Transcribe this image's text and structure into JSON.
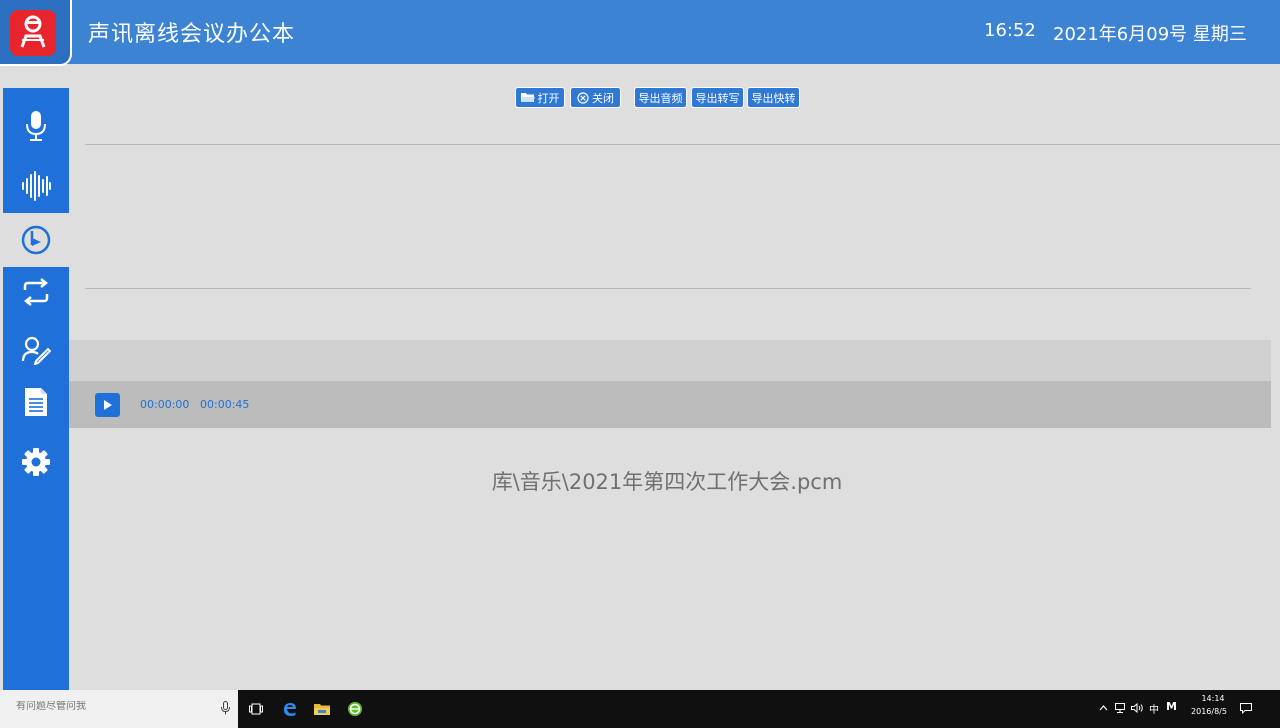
{
  "header": {
    "title": "声讯离线会议办公本",
    "time": "16:52",
    "date": "2021年6月09号  星期三"
  },
  "sidebar": {
    "items": [
      {
        "icon": "microphone-icon"
      },
      {
        "icon": "waveform-icon"
      },
      {
        "icon": "playback-icon"
      },
      {
        "icon": "convert-icon"
      },
      {
        "icon": "sign-icon"
      },
      {
        "icon": "document-icon"
      },
      {
        "icon": "gear-icon"
      }
    ]
  },
  "toolbar": {
    "open_label": "打开",
    "close_label": "关闭",
    "export_audio_label": "导出音频",
    "export_transcript_label": "导出转写",
    "export_quick_label": "导出快转"
  },
  "player": {
    "current_time": "00:00:00",
    "total_time": "00:00:45",
    "filename": "库\\音乐\\2021年第四次工作大会.pcm"
  },
  "taskbar": {
    "search_placeholder": "有问题尽管问我",
    "ime_label": "中",
    "ime_mode": "M",
    "clock_time": "14:14",
    "clock_date": "2016/8/5"
  },
  "colors": {
    "header": "#3d83d3",
    "sidebar": "#1f70d8",
    "accent": "#2f78d4",
    "logo": "#e8242c"
  }
}
